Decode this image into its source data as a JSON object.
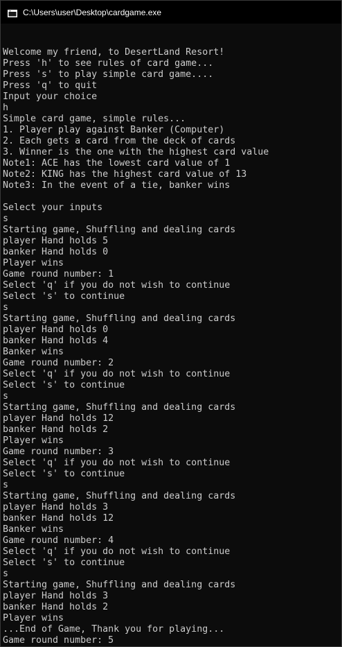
{
  "window": {
    "title": "C:\\Users\\user\\Desktop\\cardgame.exe"
  },
  "console": {
    "lines": [
      "Welcome my friend, to DesertLand Resort!",
      "Press 'h' to see rules of card game...",
      "Press 's' to play simple card game....",
      "Press 'q' to quit",
      "Input your choice",
      "h",
      "Simple card game, simple rules...",
      "1. Player play against Banker (Computer)",
      "2. Each gets a card from the deck of cards",
      "3. Winner is the one with the highest card value",
      "Note1: ACE has the lowest card value of 1",
      "Note2: KING has the highest card value of 13",
      "Note3: In the event of a tie, banker wins",
      "",
      "Select your inputs",
      "s",
      "Starting game, Shuffling and dealing cards",
      "player Hand holds 5",
      "banker Hand holds 0",
      "Player wins",
      "Game round number: 1",
      "Select 'q' if you do not wish to continue",
      "Select 's' to continue",
      "s",
      "Starting game, Shuffling and dealing cards",
      "player Hand holds 0",
      "banker Hand holds 4",
      "Banker wins",
      "Game round number: 2",
      "Select 'q' if you do not wish to continue",
      "Select 's' to continue",
      "s",
      "Starting game, Shuffling and dealing cards",
      "player Hand holds 12",
      "banker Hand holds 2",
      "Player wins",
      "Game round number: 3",
      "Select 'q' if you do not wish to continue",
      "Select 's' to continue",
      "s",
      "Starting game, Shuffling and dealing cards",
      "player Hand holds 3",
      "banker Hand holds 12",
      "Banker wins",
      "Game round number: 4",
      "Select 'q' if you do not wish to continue",
      "Select 's' to continue",
      "s",
      "Starting game, Shuffling and dealing cards",
      "player Hand holds 3",
      "banker Hand holds 2",
      "Player wins",
      "...End of Game, Thank you for playing...",
      "Game round number: 5"
    ]
  }
}
